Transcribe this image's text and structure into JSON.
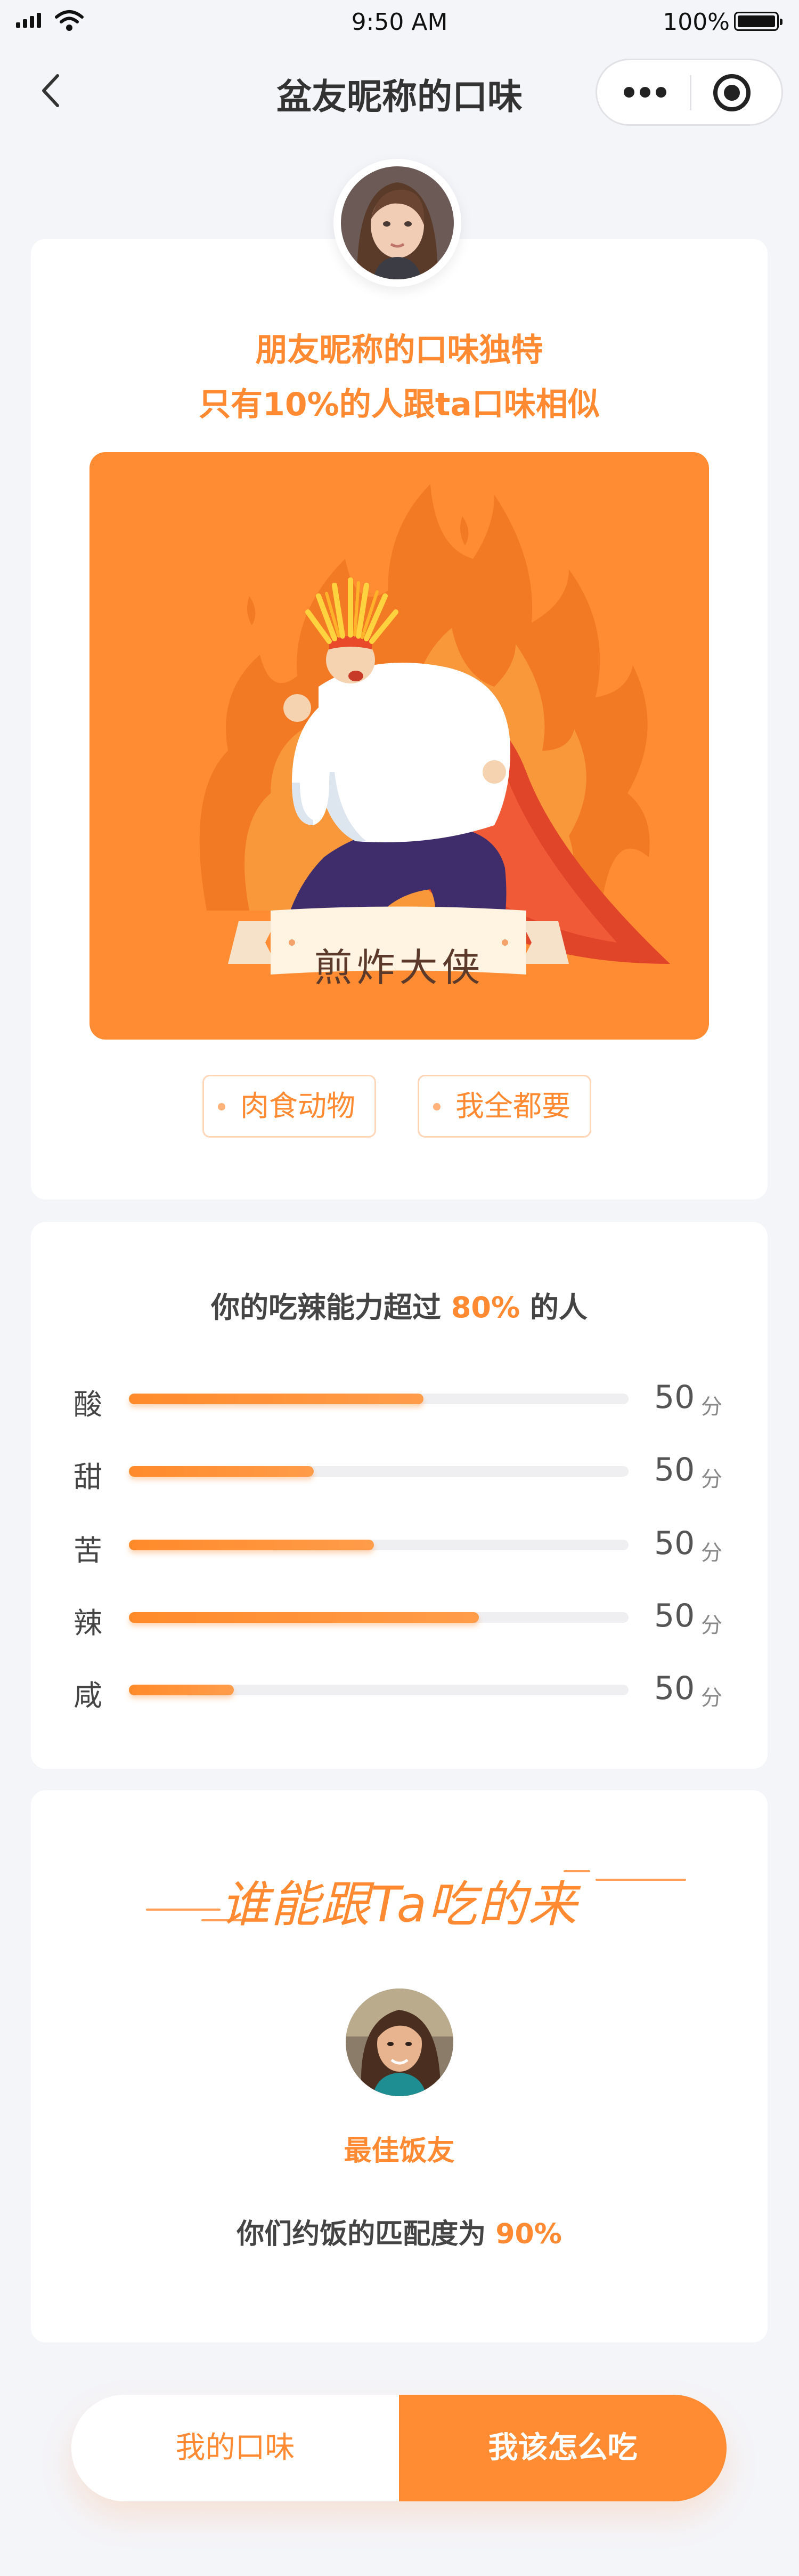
{
  "status_bar": {
    "time": "9:50 AM",
    "battery": "100%"
  },
  "nav": {
    "title": "盆友昵称的口味"
  },
  "profile_card": {
    "headline_line1": "朋友昵称的口味独特",
    "headline_line2": "只有10%的人跟ta口味相似",
    "hero_title": "煎炸大侠",
    "tags": [
      "肉食动物",
      "我全都要"
    ]
  },
  "taste_card": {
    "summary_prefix": "你的吃辣能力超过",
    "summary_percent": "80%",
    "summary_suffix": "的人",
    "score_unit": "分",
    "tastes": [
      {
        "label": "酸",
        "score": "50",
        "level": 0.59
      },
      {
        "label": "甜",
        "score": "50",
        "level": 0.37
      },
      {
        "label": "苦",
        "score": "50",
        "level": 0.49
      },
      {
        "label": "辣",
        "score": "50",
        "level": 0.7
      },
      {
        "label": "咸",
        "score": "50",
        "level": 0.21
      }
    ]
  },
  "match_card": {
    "title": "谁能跟Ta吃的来",
    "friend_label": "最佳饭友",
    "match_prefix": "你们约饭的匹配度为",
    "match_percent": "90%"
  },
  "bottom": {
    "left_label": "我的口味",
    "right_label": "我该怎么吃"
  },
  "colors": {
    "accent": "#ff8c33",
    "background": "#f4f5f9"
  }
}
